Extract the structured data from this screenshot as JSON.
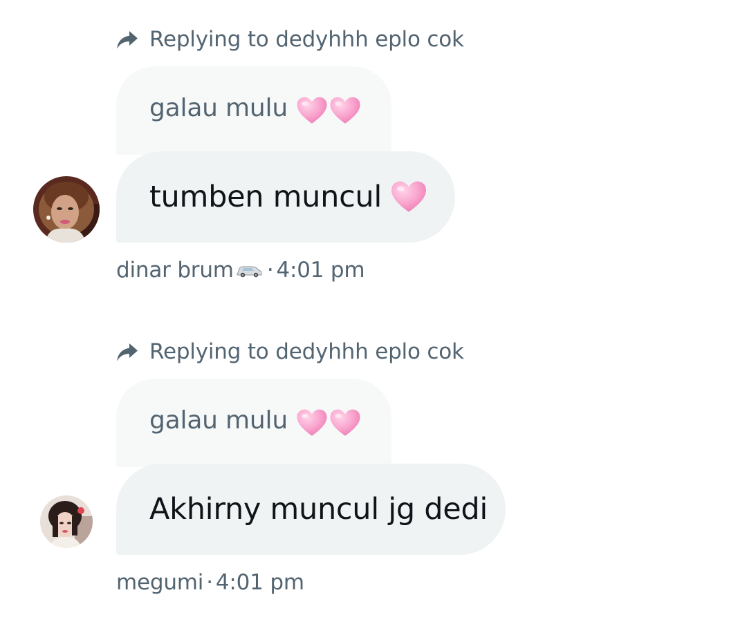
{
  "messages": [
    {
      "reply_to": "Replying to dedyhhh eplo cok",
      "quoted_text": "galau mulu",
      "quoted_emoji": "two-pink-hearts",
      "body_text": "tumben muncul",
      "body_emoji": "pink-heart",
      "author": "dinar brum",
      "author_emoji": "car",
      "separator": "·",
      "time": "4:01 pm"
    },
    {
      "reply_to": "Replying to dedyhhh eplo cok",
      "quoted_text": "galau mulu",
      "quoted_emoji": "two-pink-hearts",
      "body_text": "Akhirny muncul jg dedi",
      "author": "megumi",
      "separator": "·",
      "time": "4:01 pm"
    }
  ],
  "colors": {
    "secondary_text": "#536471",
    "primary_text": "#0f1419",
    "quoted_bubble": "#f7f9f9",
    "message_bubble": "#eff3f4",
    "heart": "#f7a4cf"
  },
  "icons": {
    "reply": "reply-arrow-icon",
    "heart": "pink-heart-icon",
    "car": "car-icon"
  }
}
